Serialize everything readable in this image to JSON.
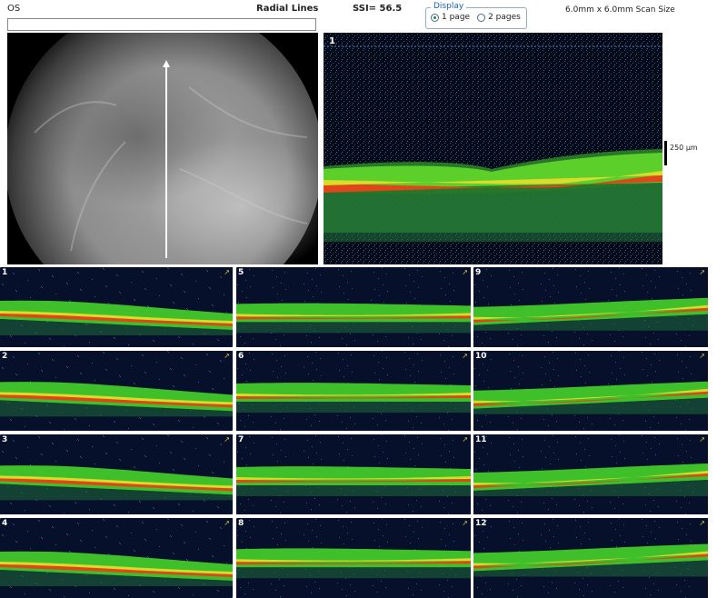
{
  "header": {
    "eye": "OS",
    "scan_pattern": "Radial Lines",
    "ssi": "SSI= 56.5",
    "display_legend": "Display",
    "display_options": [
      "1 page",
      "2 pages"
    ],
    "display_selected": "1 page",
    "scan_size": "6.0mm x 6.0mm Scan Size"
  },
  "main_scan": {
    "number": "1",
    "scale_label": "250 µm"
  },
  "colors": {
    "tissue_green": "#3fbf2a",
    "tissue_yellow": "#d8dc2a",
    "rpe_red": "#e0461a",
    "noise_blue": "#1a3f7a",
    "background": "#050a18"
  },
  "thumbnails": [
    {
      "number": "1",
      "tissue_y": 0.58
    },
    {
      "number": "2",
      "tissue_y": 0.55
    },
    {
      "number": "3",
      "tissue_y": 0.55
    },
    {
      "number": "4",
      "tissue_y": 0.58
    },
    {
      "number": "5",
      "tissue_y": 0.55
    },
    {
      "number": "6",
      "tissue_y": 0.5
    },
    {
      "number": "7",
      "tissue_y": 0.5
    },
    {
      "number": "8",
      "tissue_y": 0.48
    },
    {
      "number": "9",
      "tissue_y": 0.52
    },
    {
      "number": "10",
      "tissue_y": 0.52
    },
    {
      "number": "11",
      "tissue_y": 0.5
    },
    {
      "number": "12",
      "tissue_y": 0.46
    }
  ]
}
